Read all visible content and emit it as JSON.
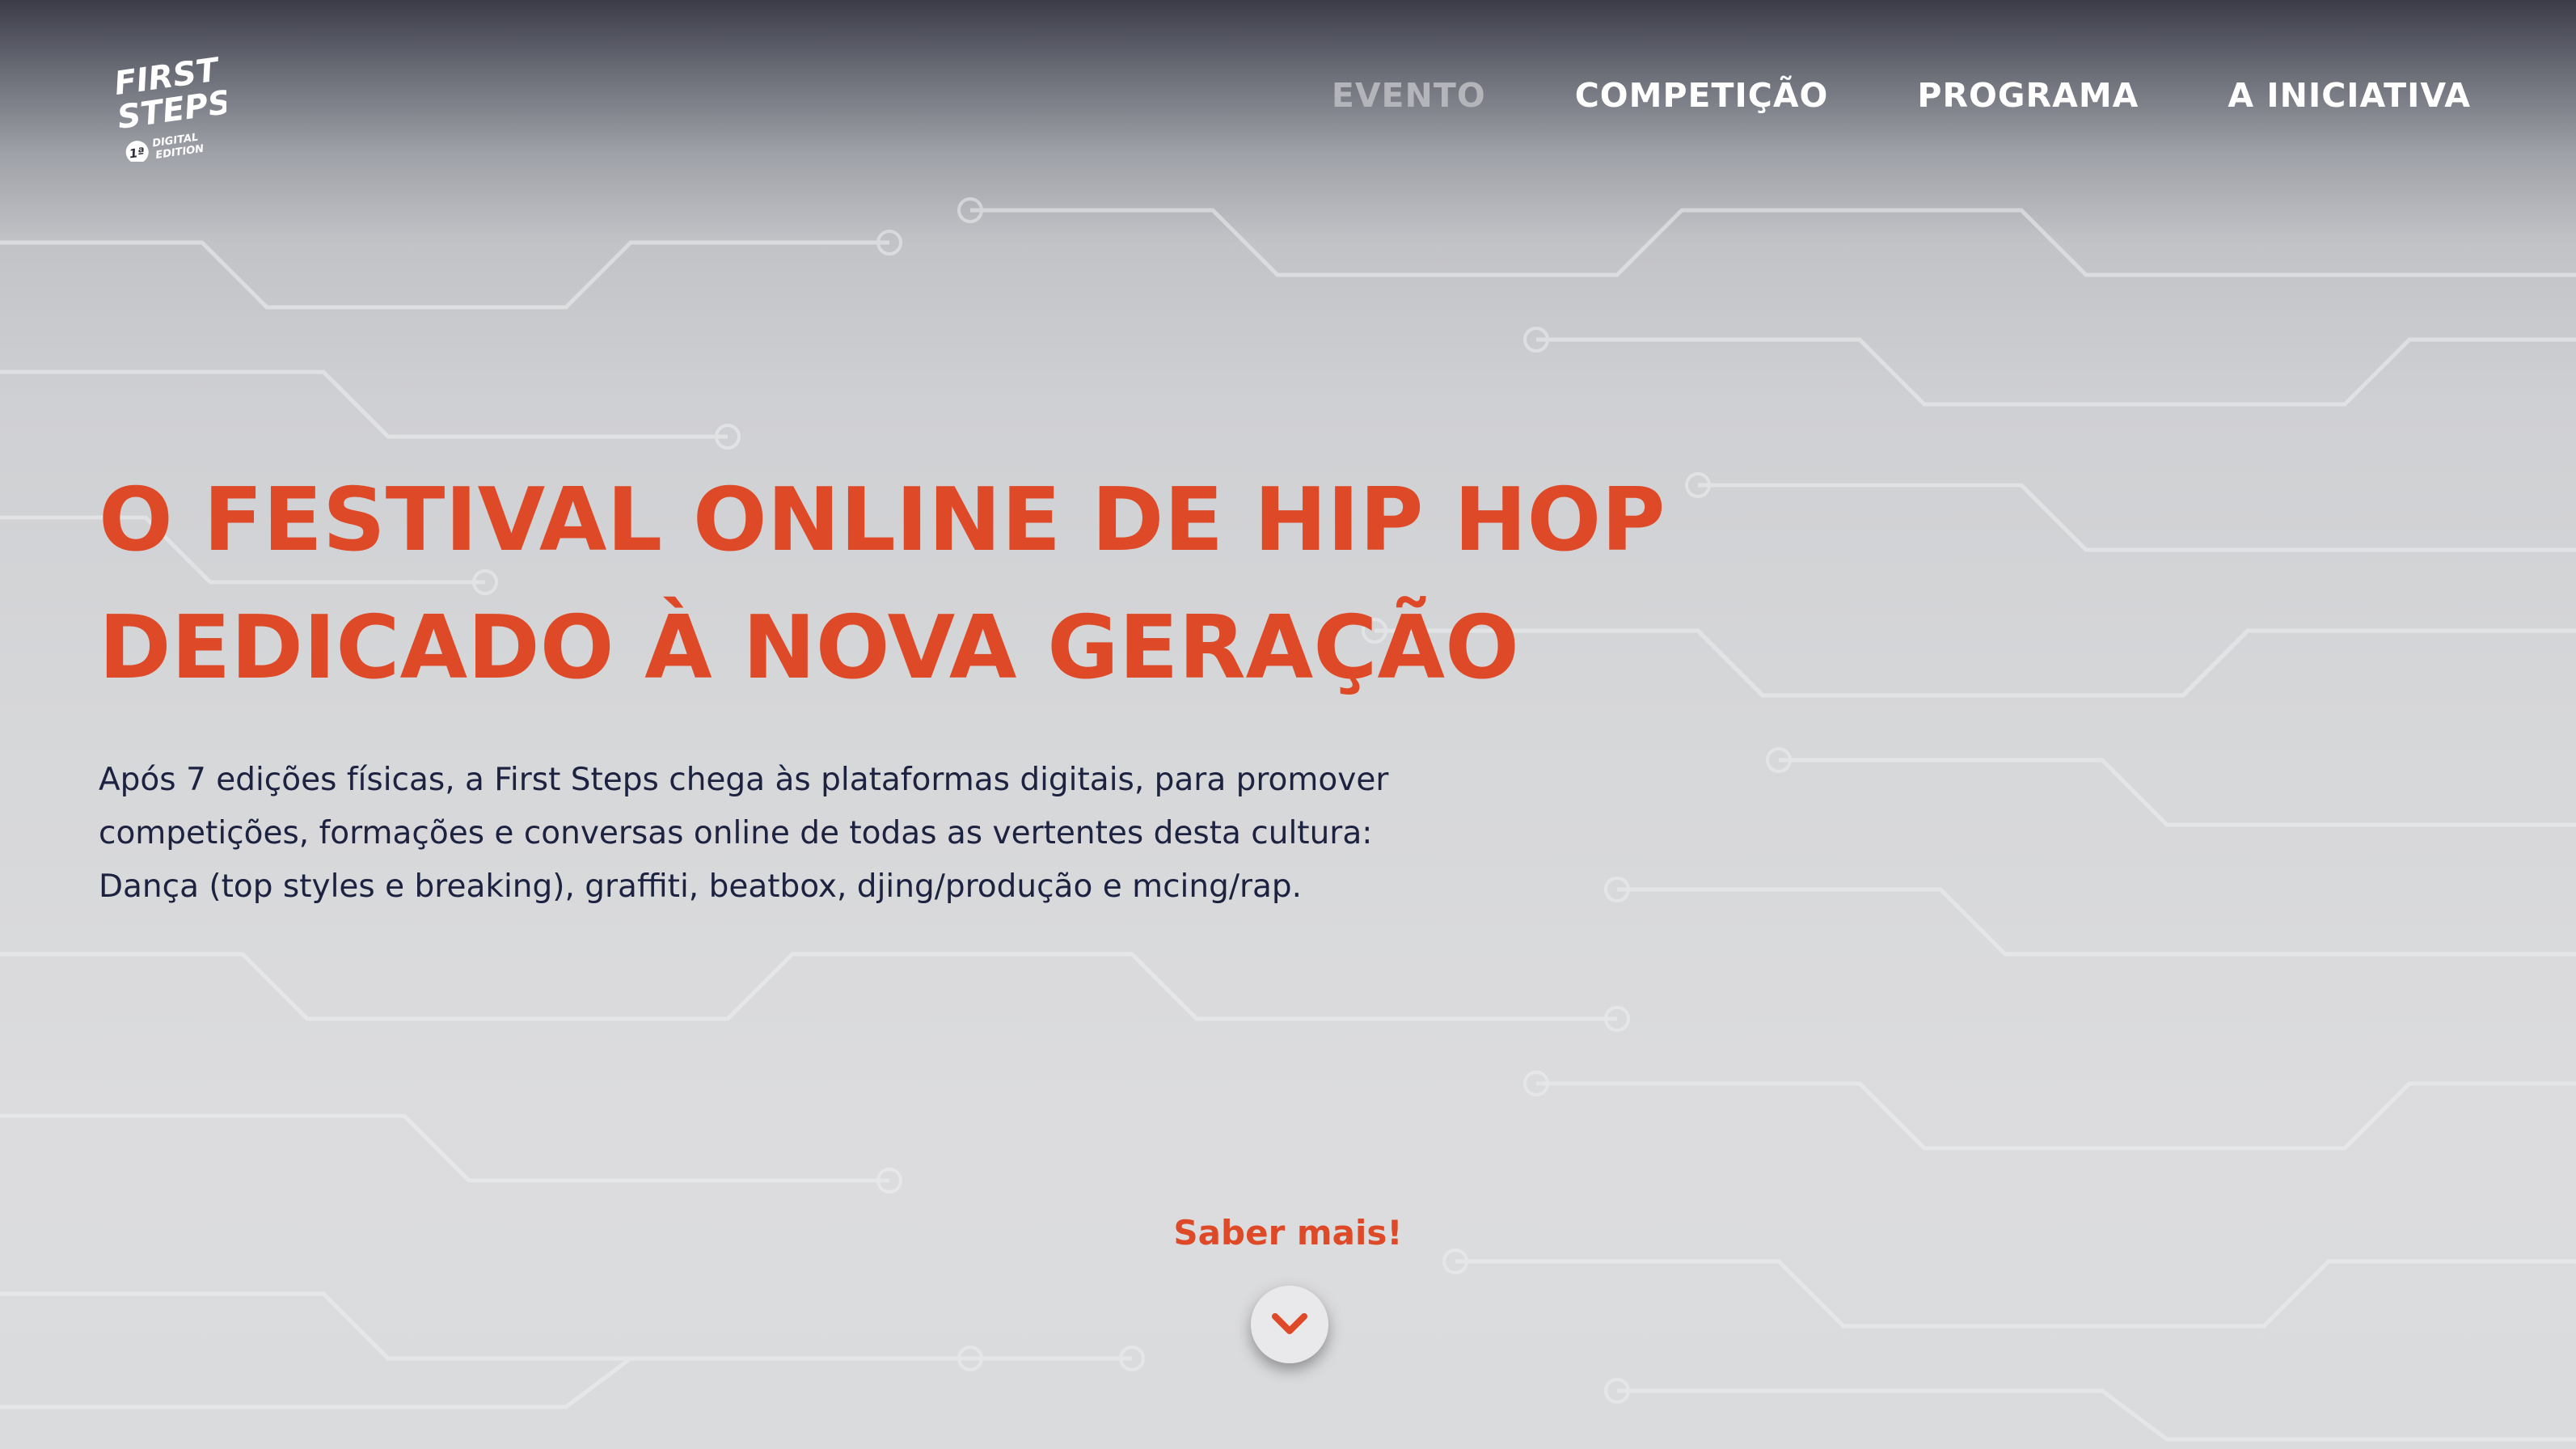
{
  "header": {
    "logo_line1": "FIRST",
    "logo_line2": "STEPS",
    "logo_edition_number": "1ª",
    "logo_edition_line1": "DIGITAL",
    "logo_edition_line2": "EDITION",
    "nav": [
      {
        "label": "EVENTO",
        "active": true
      },
      {
        "label": "COMPETIÇÃO",
        "active": false
      },
      {
        "label": "PROGRAMA",
        "active": false
      },
      {
        "label": "A INICIATIVA",
        "active": false
      }
    ]
  },
  "hero": {
    "title_line1": "O FESTIVAL ONLINE DE HIP HOP",
    "title_line2": "DEDICADO À NOVA GERAÇÃO",
    "text_line1": "Após 7 edições físicas, a First Steps chega às plataformas digitais, para promover",
    "text_line2": "competições, formações e conversas online de todas as vertentes desta cultura:",
    "text_line3": "Dança (top styles e breaking),  graffiti, beatbox, djing/produção e mcing/rap."
  },
  "cta": {
    "label": "Saber mais!",
    "icon": "chevron-down-icon"
  },
  "colors": {
    "accent": "#de4a27",
    "nav_text": "#ffffff",
    "nav_active": "#b4b5ba",
    "body_text": "#1d2240"
  }
}
